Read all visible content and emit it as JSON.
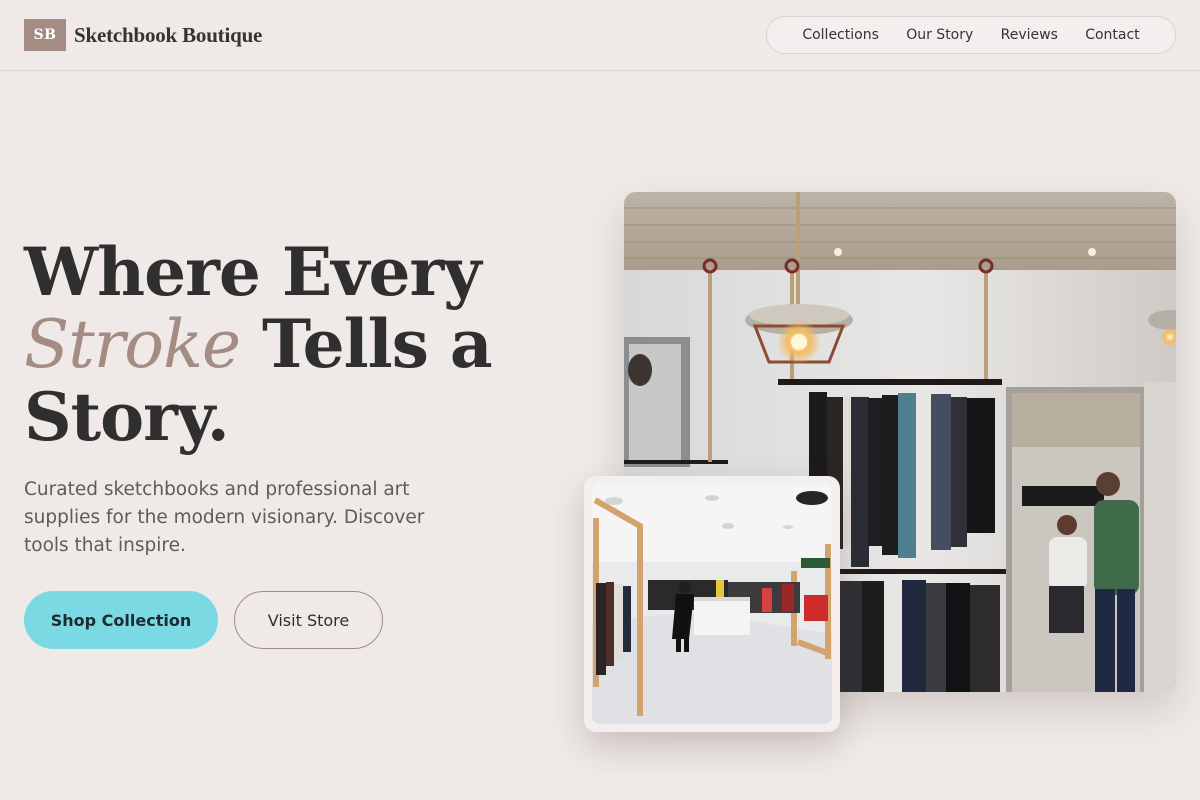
{
  "brand": {
    "mark": "SB",
    "name": "Sketchbook Boutique"
  },
  "nav": {
    "items": [
      {
        "label": "Collections"
      },
      {
        "label": "Our Story"
      },
      {
        "label": "Reviews"
      },
      {
        "label": "Contact"
      }
    ]
  },
  "hero": {
    "title_line1": "Where Every",
    "title_accent": "Stroke",
    "title_line2_rest": " Tells a",
    "title_line3": "Story.",
    "subtitle": "Curated sketchbooks and professional art supplies for the modern visionary. Discover tools that inspire.",
    "primary_cta": "Shop Collection",
    "secondary_cta": "Visit Store"
  },
  "images": {
    "main_alt": "Boutique interior with hanging clothing racks and pendant lamps",
    "secondary_alt": "Bright retail store interior with clothing racks"
  },
  "colors": {
    "background": "#efe9e7",
    "accent": "#a38c84",
    "primary_button": "#7ad9e2",
    "text": "#2f2f2f"
  }
}
